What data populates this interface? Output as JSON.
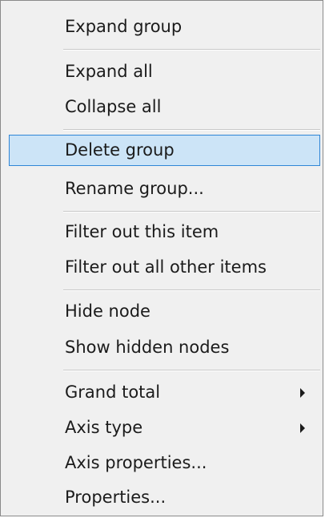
{
  "context_menu": {
    "items": [
      {
        "label": "Expand group"
      },
      {
        "label": "Expand all"
      },
      {
        "label": "Collapse all"
      },
      {
        "label": "Delete group",
        "highlighted": true
      },
      {
        "label": "Rename group..."
      },
      {
        "label": "Filter out this item"
      },
      {
        "label": "Filter out all other items"
      },
      {
        "label": "Hide node"
      },
      {
        "label": "Show hidden nodes"
      },
      {
        "label": "Grand total",
        "submenu_icon": "submenu-arrow-icon"
      },
      {
        "label": "Axis type",
        "submenu_icon": "submenu-arrow-icon"
      },
      {
        "label": "Axis properties..."
      },
      {
        "label": "Properties..."
      }
    ],
    "colors": {
      "background": "#f0f0f0",
      "highlight_fill": "#cce4f7",
      "highlight_border": "#2f86d6",
      "text": "#1b1b1b",
      "separator": "#c8c8c8"
    }
  }
}
